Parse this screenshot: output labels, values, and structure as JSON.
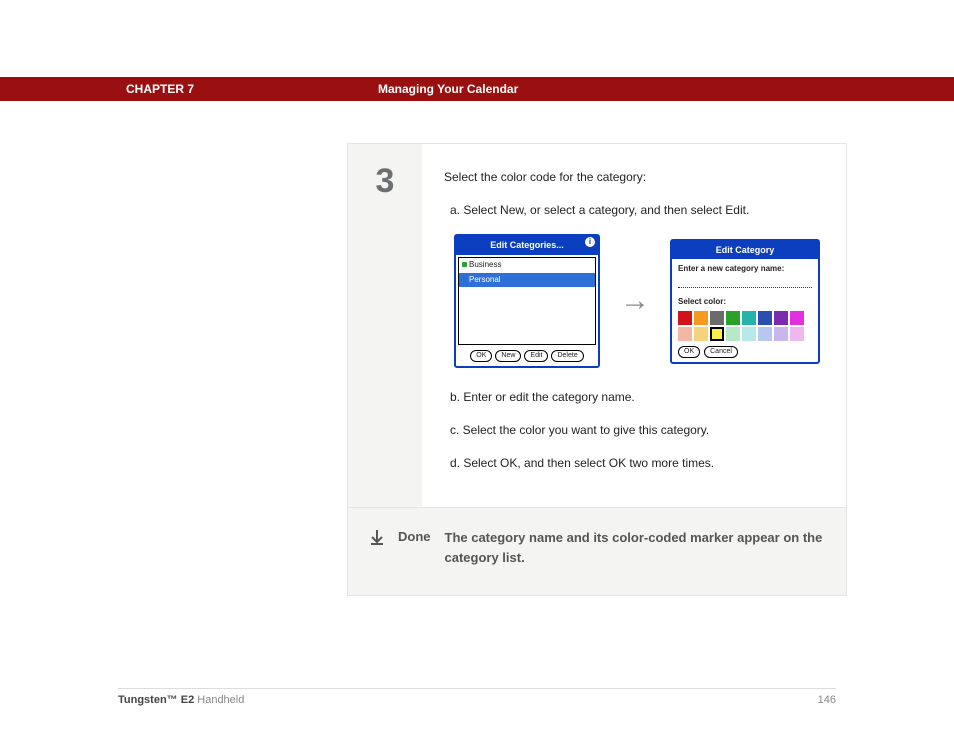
{
  "header": {
    "chapter": "CHAPTER 7",
    "title": "Managing Your Calendar"
  },
  "step": {
    "number": "3",
    "intro": "Select the color code for the category:",
    "sub_a": "a.  Select New, or select a category, and then select Edit.",
    "sub_b": "b.  Enter or edit the category name.",
    "sub_c": "c.  Select the color you want to give this category.",
    "sub_d": "d.  Select OK, and then select OK two more times."
  },
  "dialog1": {
    "title": "Edit Categories...",
    "item1": "Business",
    "item2": "Personal",
    "btn_ok": "OK",
    "btn_new": "New",
    "btn_edit": "Edit",
    "btn_delete": "Delete"
  },
  "arrow": "→",
  "dialog2": {
    "title": "Edit Category",
    "enter_label": "Enter a new category name:",
    "select_label": "Select color:",
    "colors": [
      "#d1121a",
      "#f59a1f",
      "#6b6b6b",
      "#2aa22a",
      "#24b4a8",
      "#2b4fb0",
      "#7a2bb0",
      "#e22fe0",
      "#f3b7a5",
      "#f7d27a",
      "#f7ef4a",
      "#b7e9c9",
      "#b7e9e9",
      "#b7c7ef",
      "#c7b7ef",
      "#efb7ef"
    ],
    "selected": 10,
    "btn_ok": "OK",
    "btn_cancel": "Cancel"
  },
  "done": {
    "label": "Done",
    "text": "The category name and its color-coded marker appear on the category list."
  },
  "footer": {
    "product_bold": "Tungsten™ E2",
    "product_rest": " Handheld",
    "page": "146"
  }
}
